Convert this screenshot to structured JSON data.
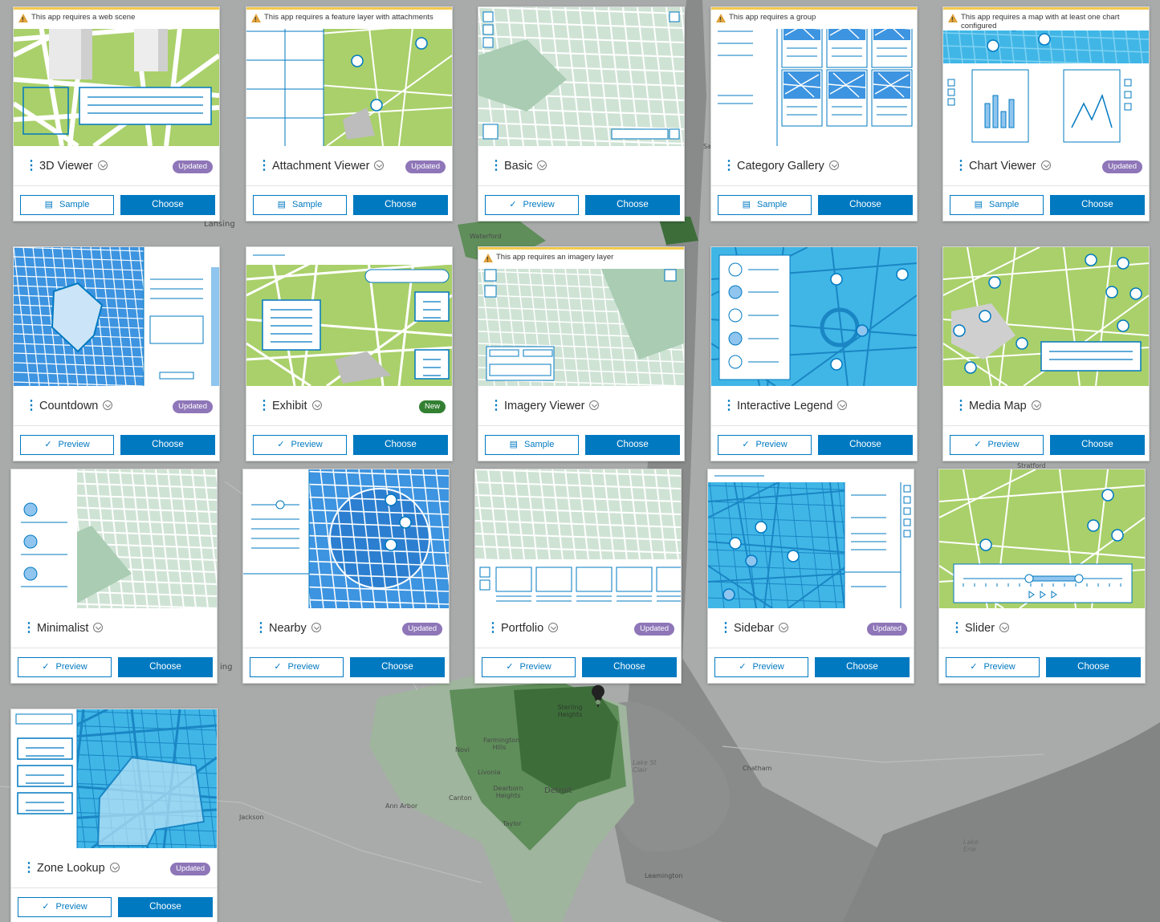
{
  "map": {
    "labels": [
      "Lansing",
      "Waterford",
      "Novi",
      "Canton",
      "Sterling Heights",
      "Farmington Hills",
      "Livonia",
      "Dearborn Heights",
      "Detroit",
      "Taylor",
      "Ann Arbor",
      "Jackson",
      "Lake St Clair",
      "Chatham",
      "Lake Erie",
      "Leamington",
      "Stratford",
      "Sa",
      "ing"
    ]
  },
  "cards": [
    {
      "title": "3D Viewer",
      "badge": "Updated",
      "warning": "This app requires a web scene",
      "secondary": "Sample",
      "secondary_icon": "sample-icon",
      "primary": "Choose"
    },
    {
      "title": "Attachment Viewer",
      "badge": "Updated",
      "warning": "This app requires a feature layer with attachments",
      "secondary": "Sample",
      "secondary_icon": "sample-icon",
      "primary": "Choose"
    },
    {
      "title": "Basic",
      "badge": "",
      "warning": "",
      "secondary": "Preview",
      "secondary_icon": "lightning-icon",
      "primary": "Choose"
    },
    {
      "title": "Category Gallery",
      "badge": "",
      "warning": "This app requires a group",
      "secondary": "Sample",
      "secondary_icon": "sample-icon",
      "primary": "Choose"
    },
    {
      "title": "Chart Viewer",
      "badge": "Updated",
      "warning": "This app requires a map with at least one chart configured",
      "secondary": "Sample",
      "secondary_icon": "sample-icon",
      "primary": "Choose"
    },
    {
      "title": "Countdown",
      "badge": "Updated",
      "warning": "",
      "secondary": "Preview",
      "secondary_icon": "lightning-icon",
      "primary": "Choose"
    },
    {
      "title": "Exhibit",
      "badge": "New",
      "warning": "",
      "secondary": "Preview",
      "secondary_icon": "lightning-icon",
      "primary": "Choose"
    },
    {
      "title": "Imagery Viewer",
      "badge": "",
      "warning": "This app requires an imagery layer",
      "secondary": "Sample",
      "secondary_icon": "sample-icon",
      "primary": "Choose"
    },
    {
      "title": "Interactive Legend",
      "badge": "",
      "warning": "",
      "secondary": "Preview",
      "secondary_icon": "lightning-icon",
      "primary": "Choose"
    },
    {
      "title": "Media Map",
      "badge": "",
      "warning": "",
      "secondary": "Preview",
      "secondary_icon": "lightning-icon",
      "primary": "Choose"
    },
    {
      "title": "Minimalist",
      "badge": "",
      "warning": "",
      "secondary": "Preview",
      "secondary_icon": "lightning-icon",
      "primary": "Choose"
    },
    {
      "title": "Nearby",
      "badge": "Updated",
      "warning": "",
      "secondary": "Preview",
      "secondary_icon": "lightning-icon",
      "primary": "Choose"
    },
    {
      "title": "Portfolio",
      "badge": "Updated",
      "warning": "",
      "secondary": "Preview",
      "secondary_icon": "lightning-icon",
      "primary": "Choose"
    },
    {
      "title": "Sidebar",
      "badge": "Updated",
      "warning": "",
      "secondary": "Preview",
      "secondary_icon": "lightning-icon",
      "primary": "Choose"
    },
    {
      "title": "Slider",
      "badge": "",
      "warning": "",
      "secondary": "Preview",
      "secondary_icon": "lightning-icon",
      "primary": "Choose"
    },
    {
      "title": "Zone Lookup",
      "badge": "Updated",
      "warning": "",
      "secondary": "Preview",
      "secondary_icon": "lightning-icon",
      "primary": "Choose"
    }
  ],
  "colors": {
    "primary": "#0079c1",
    "updated_badge": "#8e76b8",
    "new_badge": "#338033",
    "warning": "#f2c94c"
  }
}
